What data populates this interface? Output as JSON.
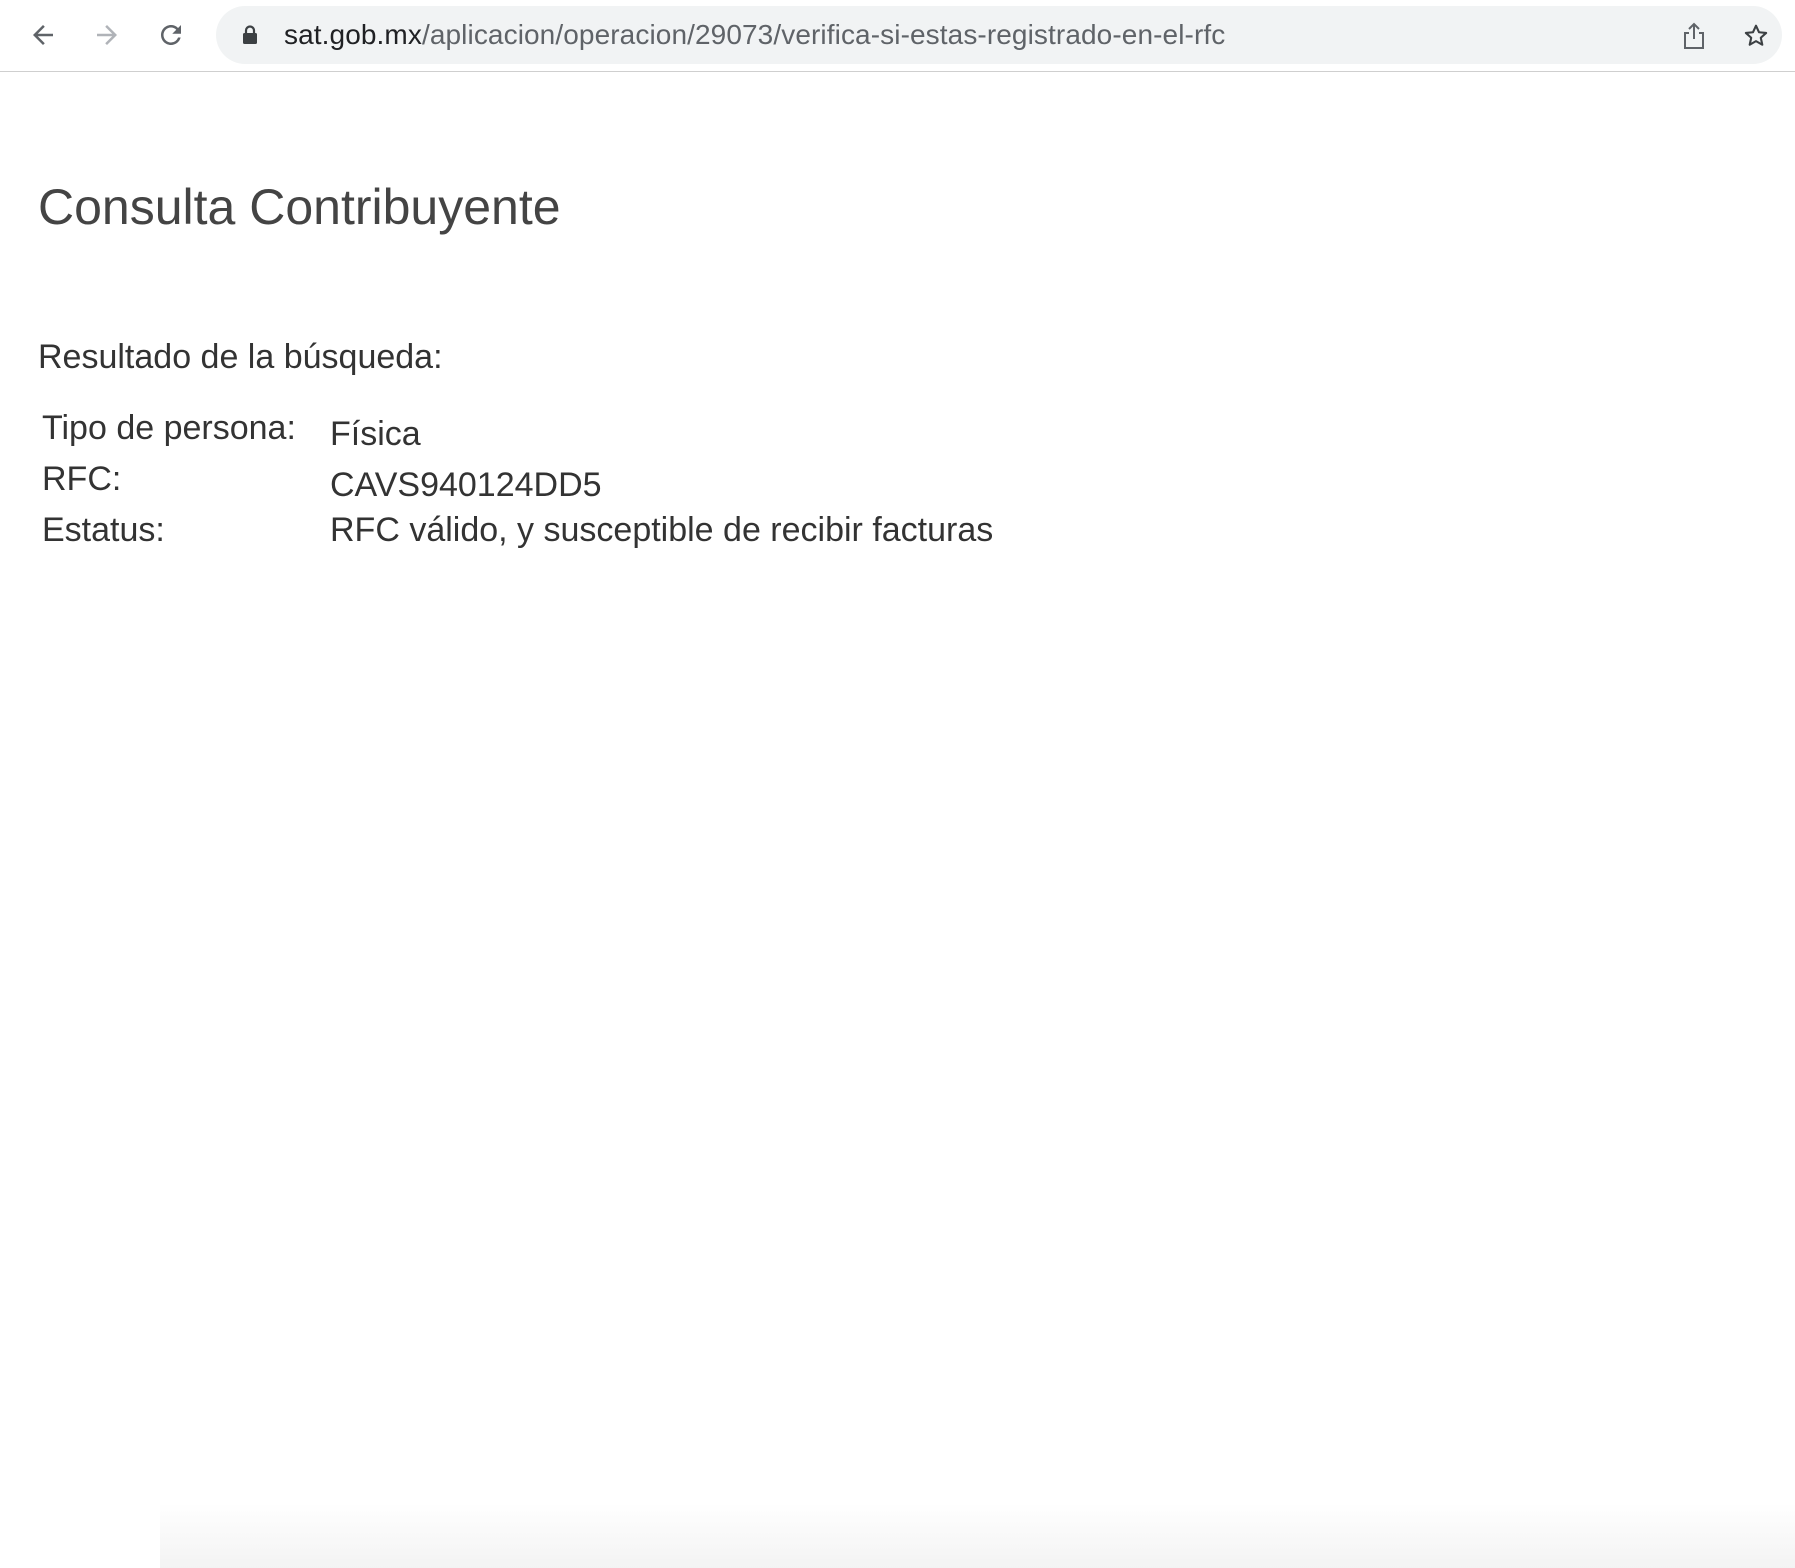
{
  "browser": {
    "url_host": "sat.gob.mx",
    "url_path": "/aplicacion/operacion/29073/verifica-si-estas-registrado-en-el-rfc",
    "icons": [
      "back-arrow-icon",
      "forward-arrow-icon",
      "reload-icon",
      "lock-icon",
      "share-icon",
      "bookmark-star-icon"
    ]
  },
  "page": {
    "title": "Consulta Contribuyente",
    "result_heading": "Resultado de la búsqueda:",
    "rows": [
      {
        "label": "Tipo de persona:",
        "value": "Física"
      },
      {
        "label": "RFC:",
        "value": "CAVS940124DD5"
      },
      {
        "label": "Estatus:",
        "value": "RFC válido, y susceptible de recibir facturas"
      }
    ]
  },
  "colors": {
    "text": "#333333",
    "title": "#444444",
    "omnibox_bg": "#f1f3f4"
  }
}
